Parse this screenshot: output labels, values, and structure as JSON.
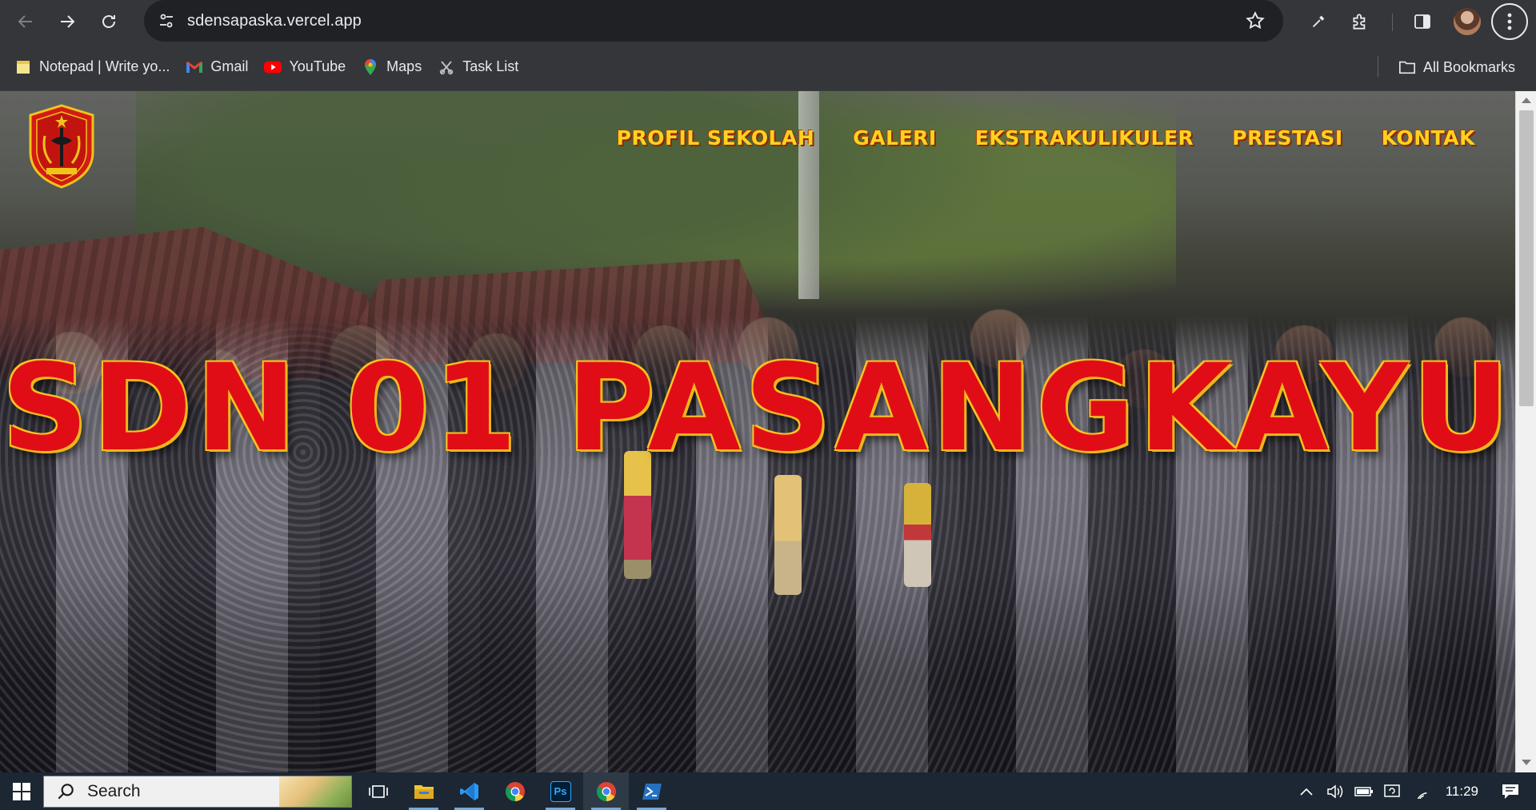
{
  "browser": {
    "url": "sdensapaska.vercel.app",
    "bookmarks": [
      {
        "label": "Notepad | Write yo...",
        "icon": "notepad-icon"
      },
      {
        "label": "Gmail",
        "icon": "gmail-icon"
      },
      {
        "label": "YouTube",
        "icon": "youtube-icon"
      },
      {
        "label": "Maps",
        "icon": "maps-icon"
      },
      {
        "label": "Task List",
        "icon": "task-list-icon"
      }
    ],
    "all_bookmarks_label": "All Bookmarks"
  },
  "site": {
    "nav": [
      "PROFIL SEKOLAH",
      "GALERI",
      "EKSTRAKULIKULER",
      "PRESTASI",
      "KONTAK"
    ],
    "hero_title": "SDN 01 PASANGKAYU",
    "colors": {
      "nav_text": "#ffd21f",
      "hero_text": "#e10d16",
      "hero_outline": "#f7c21f"
    }
  },
  "taskbar": {
    "search_label": "Search",
    "apps": [
      "task-view-icon",
      "file-explorer-icon",
      "vscode-icon",
      "chrome-icon",
      "photoshop-icon",
      "chrome-icon",
      "powershell-icon"
    ],
    "photoshop_label": "Ps",
    "time": "11:29"
  }
}
